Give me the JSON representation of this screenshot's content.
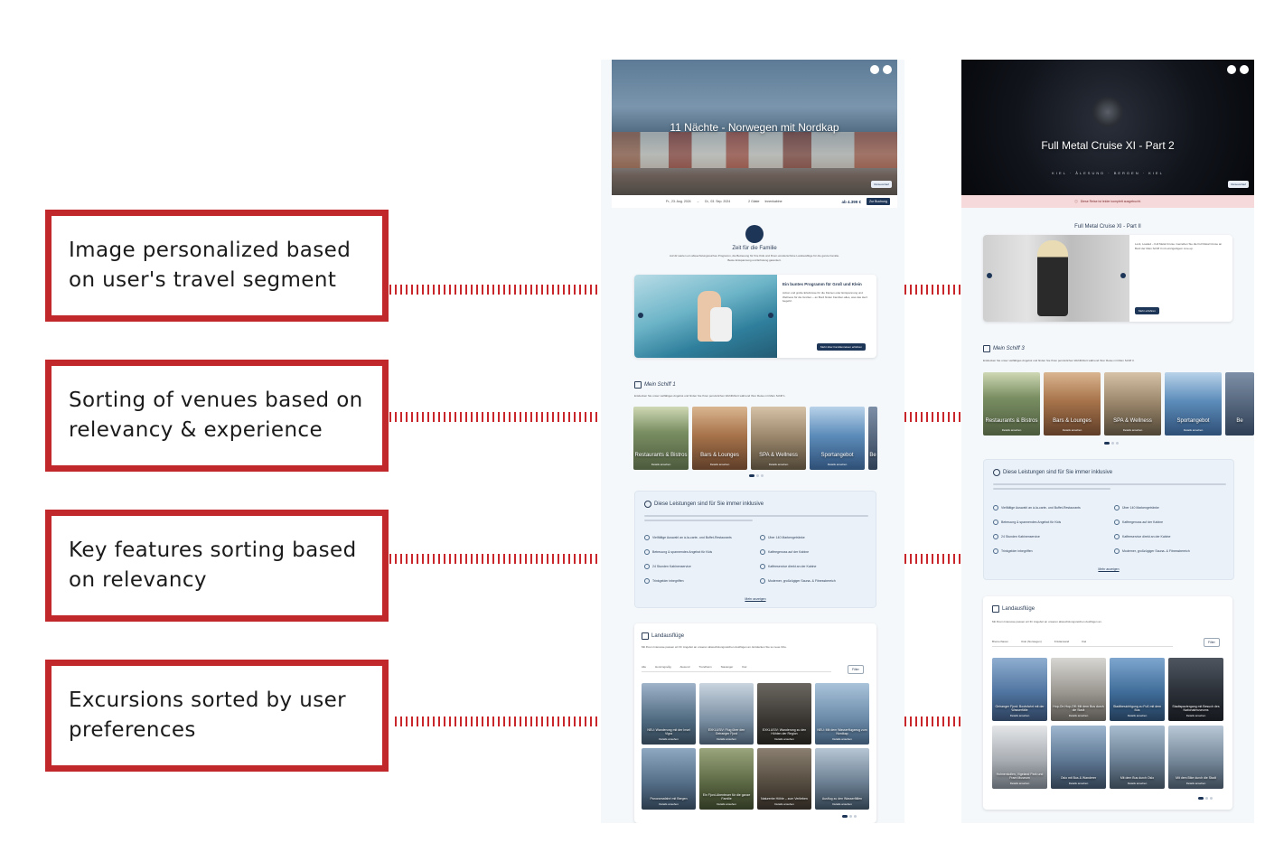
{
  "callouts": [
    {
      "text": "Image personalized based on user's travel segment"
    },
    {
      "text": "Sorting of venues based on relevancy & experience"
    },
    {
      "text": "Key features sorting based on relevancy"
    },
    {
      "text": "Excursions sorted by user preferences"
    }
  ],
  "left_phone": {
    "hero_title": "11 Nächte - Norwegen mit Nordkap",
    "hero_button": "Reiseverlauf",
    "date_from": "Fr., 23. Aug. 2024",
    "date_to": "Di., 03. Sep. 2024",
    "guests": "2 Gäste",
    "cabin": "Innenkabine",
    "price": "ab 4.399 €",
    "book_button": "Zur Buchung",
    "segment_title": "Zeit für die Familie",
    "segment_text": "Auf dir warten ein abwechslungsreiches Programm, die Betreuung für Ihre Kids und Ihnen wunderschöne Landausflüge für die ganze Familie. Beste Entspannung und Erholung garantiert.",
    "promo_title": "Ein buntes Programm für Groß und Klein",
    "promo_text": "Action und große Erlebnisse für die Kleinen oder Entspannung und Wellness für die Großen – an Bord finden Familien alles, was das Herz begehrt.",
    "promo_button": "Mehr über Familienreisen erfahren",
    "ship_section": "Mein Schiff 1",
    "ship_text": "Entdecken Sie unser vielfältiges Angebot und finden Sie Ihren persönlichen Wohlfühlort während Ihrer Reise mit Mein Schiff 1.",
    "venues": [
      {
        "label": "Restaurants & Bistros",
        "more": "Details ansehen"
      },
      {
        "label": "Bars & Lounges",
        "more": "Details ansehen"
      },
      {
        "label": "SPA & Wellness",
        "more": "Details ansehen"
      },
      {
        "label": "Sportangebot",
        "more": "Details ansehen"
      },
      {
        "label": "Be",
        "more": ""
      }
    ],
    "inclusive_title": "Diese Leistungen sind für Sie immer inklusive",
    "features": [
      "Vielfältige Auswahl an à-la-carte- und Buffet-Restaurants",
      "Über 140 Markengetränke",
      "Betreuung & spannendes Angebot für Kids",
      "Kaffeegenuss auf der Kabine",
      "24 Stunden Kabinenservice",
      "Kaffeeservice direkt an der Kabine",
      "Trinkgelder inbegriffen",
      "Moderner, großzügiger Sauna- & Fitnessbereich"
    ],
    "all_link": "Mehr anzeigen",
    "excursions_title": "Landausflüge",
    "excursions_text": "Mit Ihrem Interesse passen wir Ihr Angebot an unseren abwechslungsreichen Ausflügen an. Entdecken Sie so neue Orte.",
    "tabs": [
      "Alle",
      "Honningsvåg",
      "Alesund",
      "Trondheim",
      "Stavanger",
      "Kiel"
    ],
    "filter_label": "Filter",
    "excursions": [
      {
        "label": "NEU: Wanderung mit der Insel Vigra",
        "more": "Details ansehen"
      },
      {
        "label": "EXKLUSIV: Flug über den Geiranger Fjord",
        "more": "Details ansehen"
      },
      {
        "label": "EXKLUSIV: Wanderung zu den Höhlen der Region",
        "more": "Details ansehen"
      },
      {
        "label": "NEU: Mit dem Wasserflugzeug zum Nordkap",
        "more": "Details ansehen"
      },
      {
        "label": "Panoramafahrt mit Bergen",
        "more": "Details ansehen"
      },
      {
        "label": "Ein Fjord-Abenteuer für die ganze Familie",
        "more": "Details ansehen"
      },
      {
        "label": "Naturerbe Höhle – zum Verlieben",
        "more": "Details ansehen"
      },
      {
        "label": "Ausflug zu den Wasserfällen",
        "more": "Details ansehen"
      }
    ]
  },
  "right_phone": {
    "hero_title": "Full Metal Cruise XI - Part 2",
    "hero_sub": "KIEL · ÅLESUND · BERGEN · KIEL",
    "hero_button": "Reiseverlauf",
    "alert": "Diese Reise ist leider komplett ausgebucht.",
    "feature_title": "Full Metal Cruise XI - Part II",
    "feature_text": "Lock, Loaded – Full Metal Cruise. Genießen Sie die Full Metal Cruise an Bord der Mein Schiff 3 mit einzigartigem Line-up.",
    "feature_button": "Mehr erfahren",
    "ship_section": "Mein Schiff 3",
    "ship_text": "Entdecken Sie unser vielfältiges Angebot und finden Sie Ihren persönlichen Wohlfühlort während Ihrer Reise mit Mein Schiff 3.",
    "venues": [
      {
        "label": "Restaurants & Bistros",
        "more": "Details ansehen"
      },
      {
        "label": "Bars & Lounges",
        "more": "Details ansehen"
      },
      {
        "label": "SPA & Wellness",
        "more": "Details ansehen"
      },
      {
        "label": "Sportangebot",
        "more": "Details ansehen"
      },
      {
        "label": "Be",
        "more": ""
      }
    ],
    "inclusive_title": "Diese Leistungen sind für Sie immer inklusive",
    "features": [
      "Vielfältige Auswahl an à-la-carte- und Buffet-Restaurants",
      "Über 140 Markengetränke",
      "Betreuung & spannendes Angebot für Kids",
      "Kaffeegenuss auf der Kabine",
      "24 Stunden Kabinenservice",
      "Kaffeeservice direkt an der Kabine",
      "Trinkgelder inbegriffen",
      "Moderner, großzügiger Sauna- & Fitnessbereich"
    ],
    "all_link": "Mehr anzeigen",
    "excursions_title": "Landausflüge",
    "excursions_text": "Mit Ihrem Interesse passen wir Ihr Angebot an unseren abwechslungsreichen Ausflügen an.",
    "tabs": [
      "Bremerhaven",
      "Oslo (Norwegen)",
      "Kristiansand",
      "Kiel"
    ],
    "filter_label": "Filter",
    "excursions": [
      {
        "label": "Geiranger Fjord: Bootsfahrt mit der Wasserfälle",
        "more": "Details ansehen"
      },
      {
        "label": "Hop-On Hop-Off: Mit dem Bus durch die Stadt",
        "more": "Details ansehen"
      },
      {
        "label": "Stadtbesichtigung zu Fuß mit dem Bus",
        "more": "Details ansehen"
      },
      {
        "label": "Stadtspaziergang mit Besuch des Nationalmuseums",
        "more": "Details ansehen"
      },
      {
        "label": "Holmenkollen, Vigeland Park und Fram Museum",
        "more": "Details ansehen"
      },
      {
        "label": "Oslo mit Bus & Wanderer",
        "more": "Details ansehen"
      },
      {
        "label": "Mit dem Bus durch Oslo",
        "more": "Details ansehen"
      },
      {
        "label": "Mit dem Bike durch die Stadt",
        "more": "Details ansehen"
      }
    ]
  },
  "colors": {
    "accent": "#c0282b",
    "navy": "#1d3557",
    "alert_bg": "#f6dadb"
  }
}
